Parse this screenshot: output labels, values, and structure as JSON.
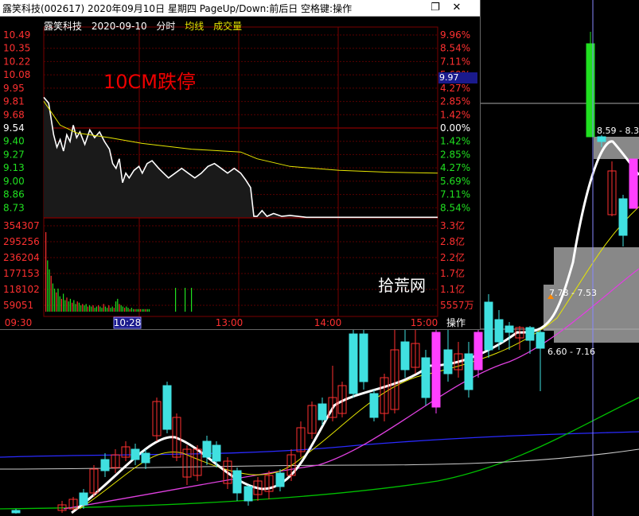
{
  "window": {
    "title": "露笑科技(002617) 2020年09月10日 星期四 PageUp/Down:前后日 空格键:操作",
    "close_icon": "close-icon",
    "restore_icon": "restore-icon"
  },
  "toolbar": {
    "stock_name": "露笑科技",
    "date": "2020-09-10",
    "mode": "分时",
    "avg_line_label": "均线",
    "volume_label": "成交量"
  },
  "annotation": "10CM跌停",
  "watermark": "拾荒网",
  "current_price_tag": "9.97",
  "operate_button": "操作",
  "colors": {
    "up": "#ff3030",
    "down": "#00c000",
    "price_line": "#ffffff",
    "avg_line": "#e6e600",
    "grid": "#7a0000",
    "background": "#000000"
  },
  "chart_data": [
    {
      "type": "line",
      "title": "分时",
      "left_price_ticks": [
        "10.49",
        "10.35",
        "10.22",
        "10.08",
        "9.95",
        "9.81",
        "9.68",
        "9.54",
        "9.40",
        "9.27",
        "9.13",
        "9.00",
        "8.86",
        "8.73"
      ],
      "right_pct_ticks": [
        "9.96%",
        "8.54%",
        "7.11%",
        "5.69%",
        "4.27%",
        "2.85%",
        "1.42%",
        "0.00%",
        "1.42%",
        "2.85%",
        "4.27%",
        "5.69%",
        "7.11%",
        "8.54%"
      ],
      "volume_left_ticks": [
        "354307",
        "295256",
        "236204",
        "177153",
        "118102",
        "59051"
      ],
      "volume_right_ticks": [
        "3.3亿",
        "2.8亿",
        "2.2亿",
        "1.7亿",
        "1.1亿",
        "5557万"
      ],
      "time_ticks": [
        "09:30",
        "10:28",
        "13:00",
        "14:00",
        "15:00"
      ],
      "prev_close": 9.54,
      "ylim": [
        8.59,
        10.49
      ],
      "series": [
        {
          "name": "价格",
          "points": [
            [
              0,
              9.84
            ],
            [
              3,
              9.78
            ],
            [
              6,
              9.45
            ],
            [
              8,
              9.32
            ],
            [
              10,
              9.4
            ],
            [
              12,
              9.28
            ],
            [
              14,
              9.45
            ],
            [
              16,
              9.38
            ],
            [
              18,
              9.55
            ],
            [
              20,
              9.42
            ],
            [
              22,
              9.48
            ],
            [
              25,
              9.35
            ],
            [
              28,
              9.5
            ],
            [
              31,
              9.42
            ],
            [
              34,
              9.48
            ],
            [
              37,
              9.38
            ],
            [
              40,
              9.3
            ],
            [
              42,
              9.15
            ],
            [
              44,
              9.1
            ],
            [
              46,
              9.2
            ],
            [
              48,
              8.95
            ],
            [
              50,
              9.05
            ],
            [
              52,
              9.0
            ],
            [
              55,
              9.08
            ],
            [
              58,
              9.12
            ],
            [
              60,
              9.05
            ],
            [
              63,
              9.15
            ],
            [
              66,
              9.18
            ],
            [
              70,
              9.1
            ],
            [
              73,
              9.05
            ],
            [
              76,
              9.0
            ],
            [
              80,
              9.05
            ],
            [
              84,
              9.1
            ],
            [
              88,
              9.05
            ],
            [
              92,
              9.0
            ],
            [
              96,
              9.05
            ],
            [
              100,
              9.12
            ],
            [
              104,
              9.15
            ],
            [
              108,
              9.1
            ],
            [
              112,
              9.05
            ],
            [
              116,
              9.1
            ],
            [
              120,
              9.05
            ],
            [
              123,
              8.98
            ],
            [
              126,
              8.9
            ],
            [
              128,
              8.6
            ],
            [
              130,
              8.6
            ],
            [
              133,
              8.66
            ],
            [
              136,
              8.6
            ],
            [
              140,
              8.63
            ],
            [
              145,
              8.6
            ],
            [
              150,
              8.61
            ],
            [
              160,
              8.59
            ],
            [
              240,
              8.59
            ]
          ]
        },
        {
          "name": "均价",
          "points": [
            [
              0,
              9.8
            ],
            [
              10,
              9.55
            ],
            [
              20,
              9.47
            ],
            [
              40,
              9.42
            ],
            [
              60,
              9.36
            ],
            [
              90,
              9.3
            ],
            [
              120,
              9.27
            ],
            [
              130,
              9.2
            ],
            [
              150,
              9.12
            ],
            [
              180,
              9.08
            ],
            [
              210,
              9.06
            ],
            [
              240,
              9.05
            ]
          ]
        }
      ],
      "volume": [
        62,
        40,
        33,
        28,
        22,
        18,
        15,
        18,
        12,
        10,
        14,
        9,
        11,
        8,
        10,
        7,
        9,
        6,
        8,
        7,
        5,
        6,
        5,
        6,
        4,
        5,
        4,
        5,
        3,
        4,
        5,
        4,
        3,
        6,
        4,
        3,
        5,
        3,
        4,
        3,
        8,
        10,
        6,
        5,
        4,
        3,
        4,
        3,
        2,
        3,
        2,
        2,
        2,
        2,
        2,
        2,
        2,
        2,
        2,
        2
      ]
    },
    {
      "type": "candlestick",
      "annotations": [
        "8.59 - 8.3",
        "7.78 - 7.53",
        "6.60 - 7.16"
      ]
    }
  ]
}
